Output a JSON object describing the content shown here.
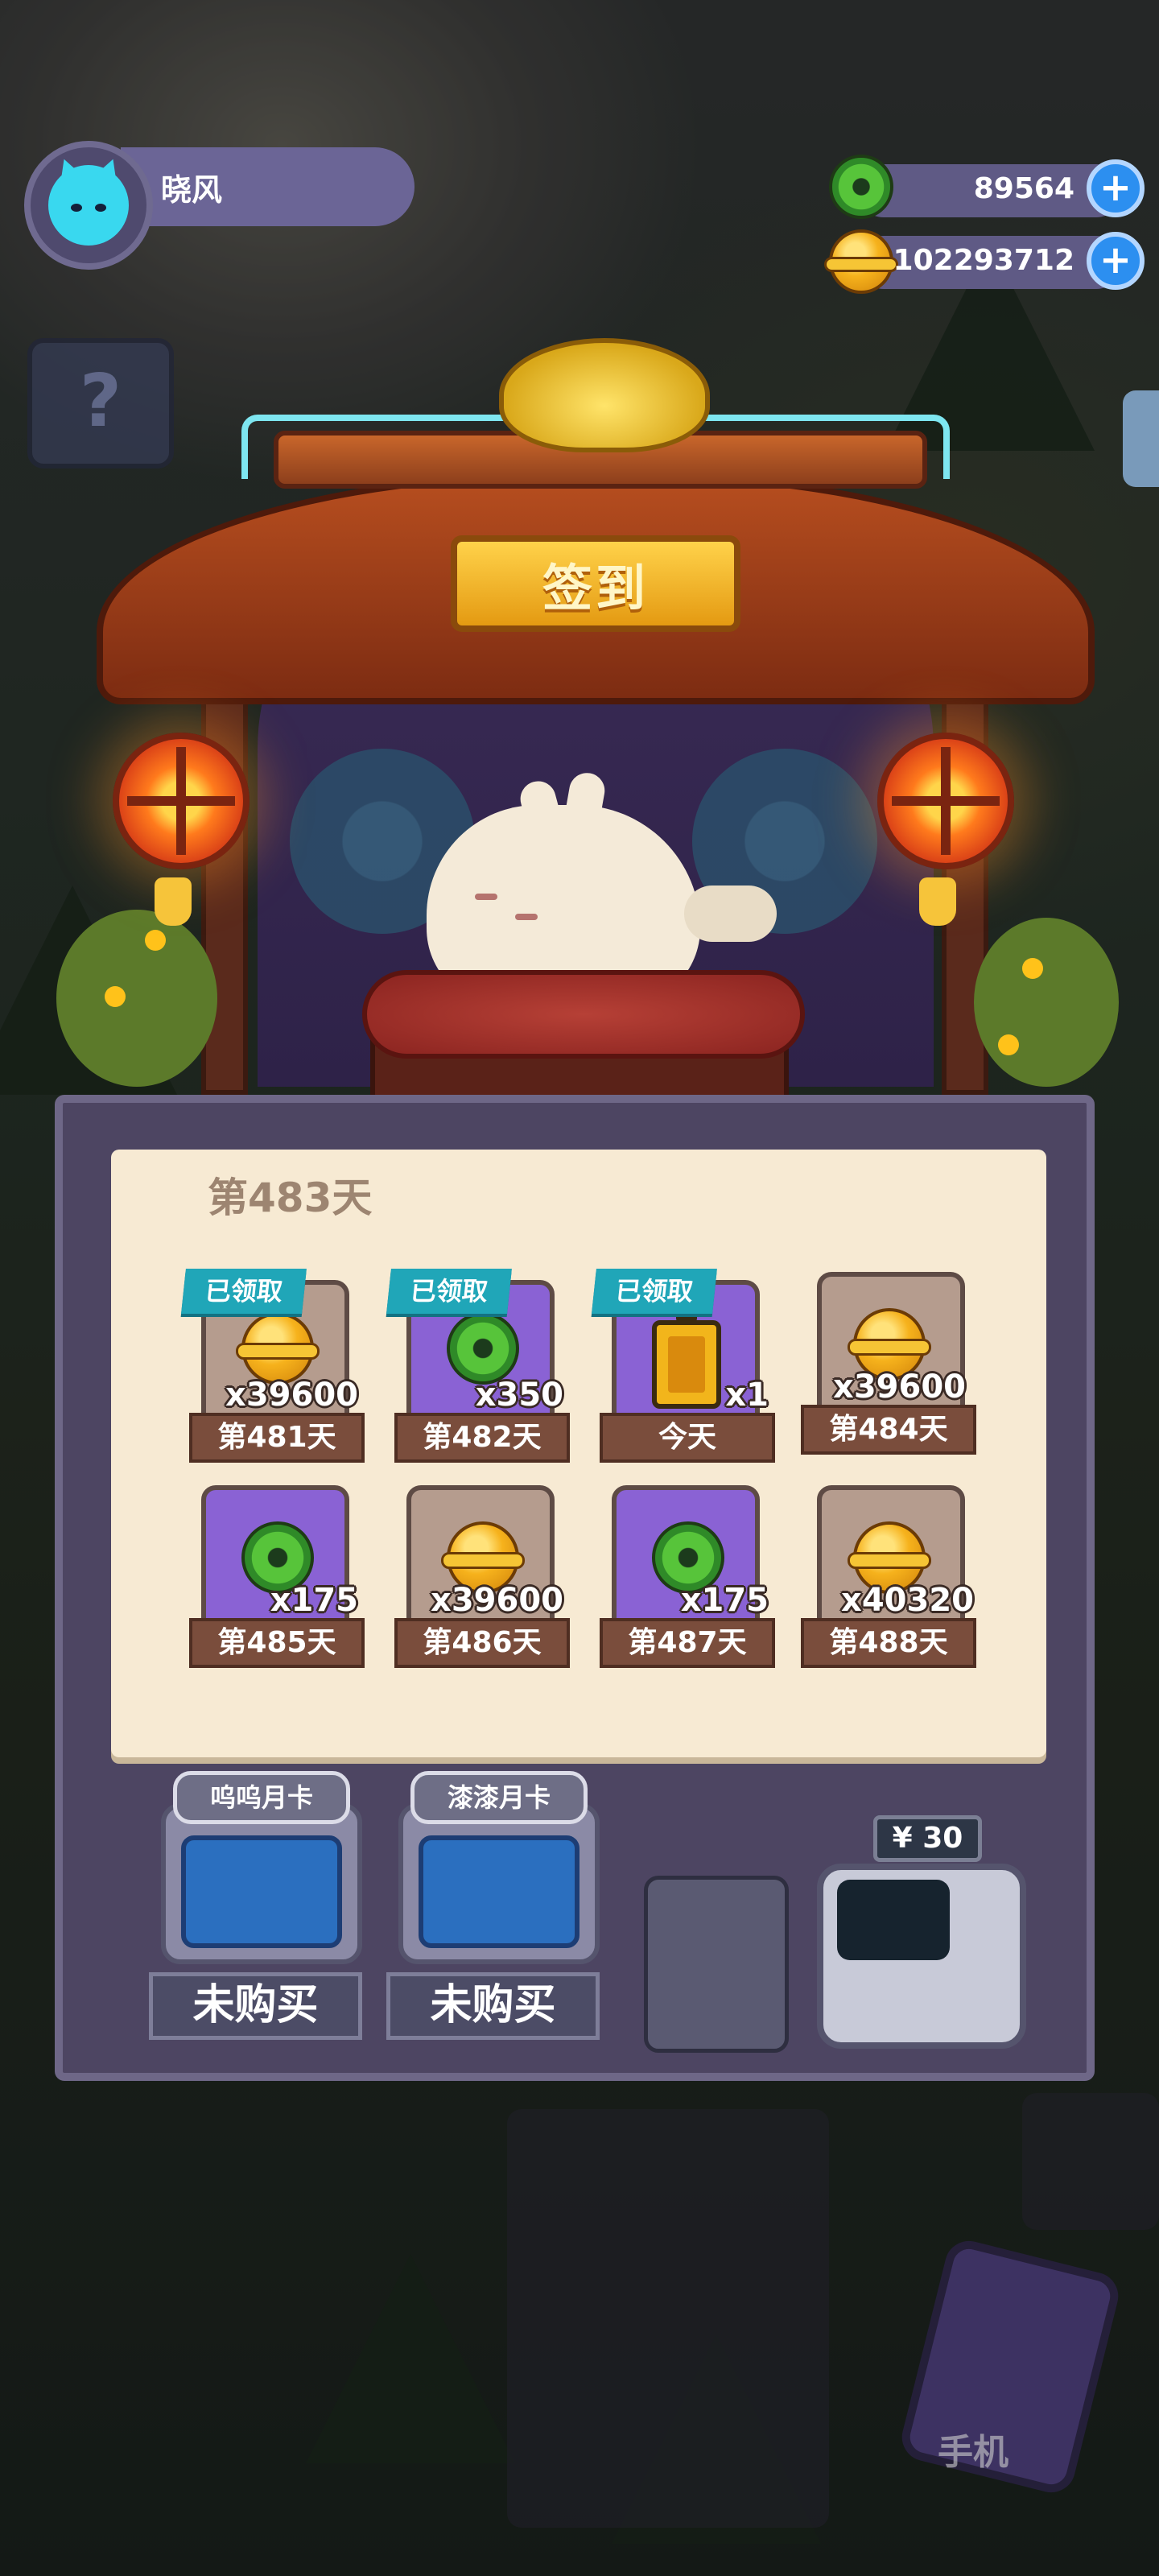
{
  "player": {
    "name": "晓风",
    "avatar_icon": "cat-avatar-icon"
  },
  "currencies": [
    {
      "name": "green-gem",
      "value": "89564",
      "icon": "green-ring-coin-icon",
      "color": "#57c43a"
    },
    {
      "name": "gold-coin",
      "value": "102293712",
      "icon": "gold-coin-icon",
      "color": "#f6b21c"
    }
  ],
  "sidebar": {
    "help_icon": "question-mark-icon",
    "help_glyph": "?"
  },
  "signin": {
    "title": "签到",
    "day_title": "第483天",
    "claimed_label": "已领取",
    "rewards": [
      {
        "day": "第481天",
        "item": "gold-coin",
        "qty": "x39600",
        "claimed": true
      },
      {
        "day": "第482天",
        "item": "green-gem",
        "qty": "x350",
        "claimed": true
      },
      {
        "day": "今天",
        "item": "battery",
        "qty": "x1",
        "claimed": true
      },
      {
        "day": "第484天",
        "item": "gold-coin",
        "qty": "x39600",
        "claimed": false
      },
      {
        "day": "第485天",
        "item": "green-gem",
        "qty": "x175",
        "claimed": false
      },
      {
        "day": "第486天",
        "item": "gold-coin",
        "qty": "x39600",
        "claimed": false
      },
      {
        "day": "第487天",
        "item": "green-gem",
        "qty": "x175",
        "claimed": false
      },
      {
        "day": "第488天",
        "item": "gold-coin",
        "qty": "x40320",
        "claimed": false
      }
    ]
  },
  "monthly_cards": [
    {
      "name": "呜呜月卡",
      "status": "未购买"
    },
    {
      "name": "漆漆月卡",
      "status": "未购买"
    }
  ],
  "vending": {
    "price": "¥ 30"
  },
  "bottom": {
    "phone_label": "手机"
  },
  "colors": {
    "panel": "#4d4562",
    "paper": "#f7ead3",
    "claimed_tag": "#20a6b8",
    "purple_slot": "#8a62d4"
  }
}
